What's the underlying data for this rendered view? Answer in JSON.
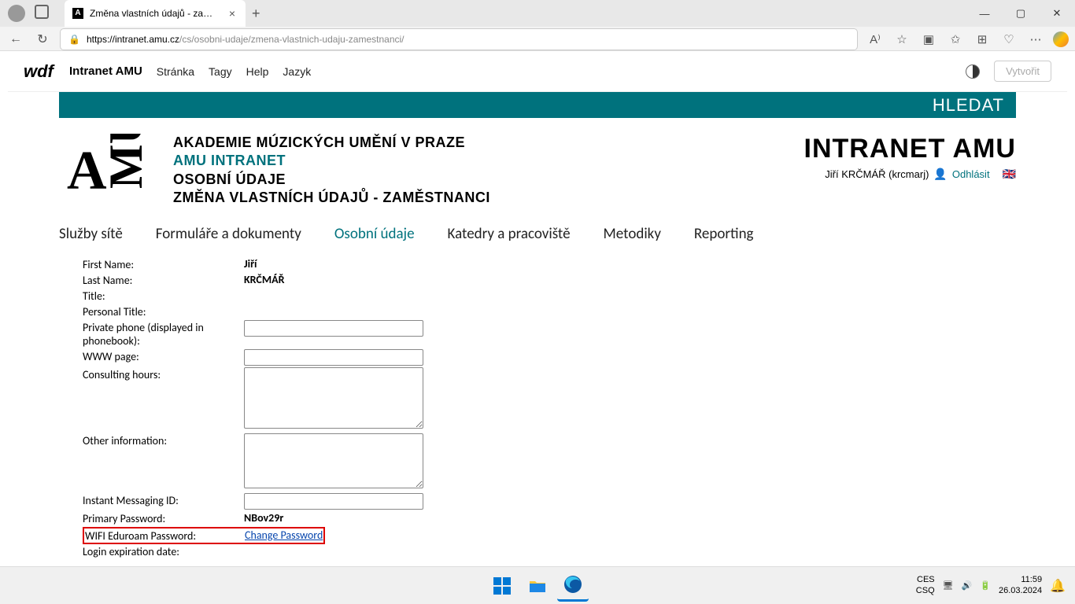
{
  "browser": {
    "tab_title": "Změna vlastních údajů - zaměstn",
    "url_host": "https://intranet.amu.cz",
    "url_path": "/cs/osobni-udaje/zmena-vlastnich-udaju-zamestnanci/"
  },
  "wdf": {
    "title": "Intranet AMU",
    "items": [
      "Stránka",
      "Tagy",
      "Help",
      "Jazyk"
    ],
    "create": "Vytvořit"
  },
  "banner": {
    "search": "HLEDAT"
  },
  "breadcrumb": {
    "line1": "AKADEMIE MÚZICKÝCH UMĚNÍ V PRAZE",
    "line2": "AMU INTRANET",
    "line3": "OSOBNÍ ÚDAJE",
    "line4": "ZMĚNA VLASTNÍCH ÚDAJŮ - ZAMĚSTNANCI"
  },
  "rightcol": {
    "title": "INTRANET AMU",
    "user": "Jiří KRČMÁŘ (krcmarj)",
    "logout": "Odhlásit"
  },
  "nav": {
    "items": [
      "Služby sítě",
      "Formuláře a dokumenty",
      "Osobní údaje",
      "Katedry a pracoviště",
      "Metodiky",
      "Reporting"
    ],
    "active_index": 2
  },
  "form": {
    "first_name": {
      "label": "First Name:",
      "value": "Jiří"
    },
    "last_name": {
      "label": "Last Name:",
      "value": "KRČMÁŘ"
    },
    "title": {
      "label": "Title:",
      "value": ""
    },
    "personal_title": {
      "label": "Personal Title:",
      "value": ""
    },
    "private_phone": {
      "label": "Private phone (displayed in phonebook):"
    },
    "www": {
      "label": "WWW page:"
    },
    "consulting": {
      "label": "Consulting hours:"
    },
    "other_info": {
      "label": "Other information:"
    },
    "im": {
      "label": "Instant Messaging ID:"
    },
    "primary_pwd": {
      "label": "Primary Password:",
      "value": "NBov29r"
    },
    "wifi_pwd": {
      "label": "WIFI Eduroam Password:",
      "link": "Change Password"
    },
    "login_exp": {
      "label": "Login expiration date:",
      "value": ""
    }
  },
  "taskbar": {
    "kbd1": "CES",
    "kbd2": "CSQ",
    "time": "11:59",
    "date": "26.03.2024"
  }
}
